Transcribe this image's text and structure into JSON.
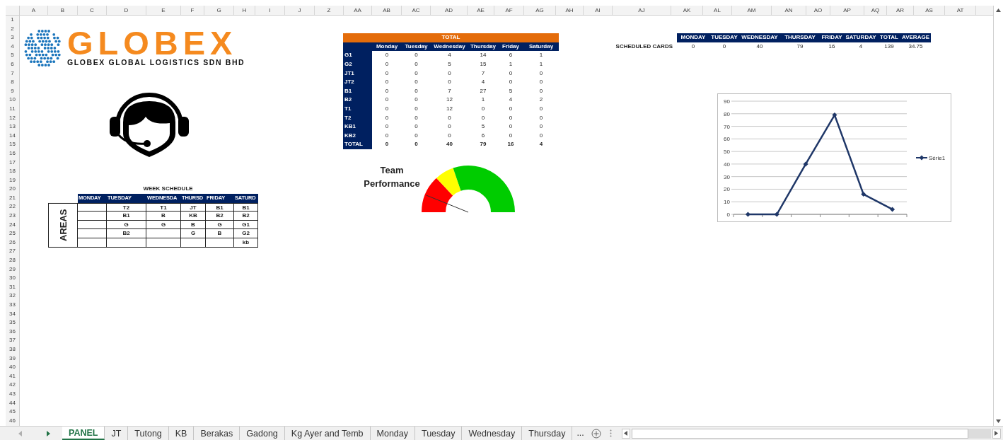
{
  "column_headers": [
    "A",
    "B",
    "C",
    "D",
    "E",
    "F",
    "G",
    "H",
    "I",
    "J",
    "Z",
    "AA",
    "AB",
    "AC",
    "AD",
    "AE",
    "AF",
    "AG",
    "AH",
    "AI",
    "AJ",
    "AK",
    "AL",
    "AM",
    "AN",
    "AO",
    "AP",
    "AQ",
    "AR",
    "AS",
    "AT"
  ],
  "row_headers": [
    "1",
    "2",
    "3",
    "4",
    "5",
    "6",
    "7",
    "8",
    "9",
    "10",
    "11",
    "12",
    "13",
    "14",
    "15",
    "16",
    "17",
    "18",
    "19",
    "20",
    "21",
    "22",
    "23",
    "24",
    "25",
    "26",
    "27",
    "28",
    "29",
    "30",
    "31",
    "32",
    "33",
    "34",
    "35",
    "36",
    "37",
    "38",
    "39",
    "40",
    "41",
    "42",
    "43",
    "44",
    "45",
    "46"
  ],
  "logo": {
    "name": "GLOBEX",
    "tagline": "GLOBEX GLOBAL LOGISTICS SDN BHD"
  },
  "week_schedule": {
    "title": "WEEK SCHEDULE",
    "side_label": "AREAS",
    "columns": [
      "MONDAY",
      "TUESDAY",
      "WEDNESDA",
      "THURSD",
      "FRIDAY",
      "SATURD"
    ],
    "rows": [
      [
        null,
        "T2",
        "T1",
        "JT",
        "B1",
        "B1"
      ],
      [
        null,
        "B1",
        "B",
        "KB",
        "B2",
        "B2"
      ],
      [
        null,
        "G",
        "G",
        "B",
        "G",
        "G1"
      ],
      [
        null,
        "B2",
        null,
        "G",
        "B",
        "G2"
      ],
      [
        null,
        null,
        null,
        null,
        null,
        "kb"
      ]
    ]
  },
  "totals_table": {
    "title": "TOTAL",
    "columns": [
      "Monday",
      "Tuesday",
      "Wednesday",
      "Thursday",
      "Friday",
      "Saturday"
    ],
    "rows": [
      {
        "label": "G1",
        "values": [
          "0",
          "0",
          "4",
          "14",
          "6",
          "1"
        ]
      },
      {
        "label": "G2",
        "values": [
          "0",
          "0",
          "5",
          "15",
          "1",
          "1"
        ]
      },
      {
        "label": "JT1",
        "values": [
          "0",
          "0",
          "0",
          "7",
          "0",
          "0"
        ]
      },
      {
        "label": "JT2",
        "values": [
          "0",
          "0",
          "0",
          "4",
          "0",
          "0"
        ]
      },
      {
        "label": "B1",
        "values": [
          "0",
          "0",
          "7",
          "27",
          "5",
          "0"
        ]
      },
      {
        "label": "B2",
        "values": [
          "0",
          "0",
          "12",
          "1",
          "4",
          "2"
        ]
      },
      {
        "label": "T1",
        "values": [
          "0",
          "0",
          "12",
          "0",
          "0",
          "0"
        ]
      },
      {
        "label": "T2",
        "values": [
          "0",
          "0",
          "0",
          "0",
          "0",
          "0"
        ]
      },
      {
        "label": "KB1",
        "values": [
          "0",
          "0",
          "0",
          "5",
          "0",
          "0"
        ]
      },
      {
        "label": "KB2",
        "values": [
          "0",
          "0",
          "0",
          "6",
          "0",
          "0"
        ]
      }
    ],
    "total": {
      "label": "TOTAL",
      "values": [
        "0",
        "0",
        "40",
        "79",
        "16",
        "4"
      ]
    }
  },
  "gauge": {
    "title": "Team Performance"
  },
  "scheduled_cards": {
    "label": "SCHEDULED CARDS",
    "columns": [
      "MONDAY",
      "TUESDAY",
      "WEDNESDAY",
      "THURSDAY",
      "FRIDAY",
      "SATURDAY",
      "TOTAL",
      "AVERAGE"
    ],
    "values": [
      "0",
      "0",
      "40",
      "79",
      "16",
      "4",
      "139",
      "34.75"
    ]
  },
  "chart": {
    "chart_data": {
      "type": "line",
      "grid": true,
      "marker": "diamond",
      "ylim": [
        0,
        90
      ],
      "yticks": [
        0,
        10,
        20,
        30,
        40,
        50,
        60,
        70,
        80,
        90
      ],
      "series": [
        {
          "name": "Série1",
          "color": "#1f3768",
          "values": [
            0,
            0,
            40,
            79,
            16,
            4
          ]
        }
      ]
    }
  },
  "sheet_nav": [
    {
      "kind": "previous",
      "disabled": true
    },
    {
      "kind": "next",
      "disabled": false
    }
  ],
  "sheet_tabs": [
    {
      "label": "PANEL",
      "selected": true
    },
    {
      "label": "JT",
      "selected": false
    },
    {
      "label": "Tutong",
      "selected": false
    },
    {
      "label": "KB",
      "selected": false
    },
    {
      "label": "Berakas",
      "selected": false
    },
    {
      "label": "Gadong",
      "selected": false
    },
    {
      "label": "Kg Ayer and Temb",
      "selected": false
    },
    {
      "label": "Monday",
      "selected": false
    },
    {
      "label": "Tuesday",
      "selected": false
    },
    {
      "label": "Wednesday",
      "selected": false
    },
    {
      "label": "Thursday",
      "selected": false
    }
  ],
  "more_tabs": "..."
}
